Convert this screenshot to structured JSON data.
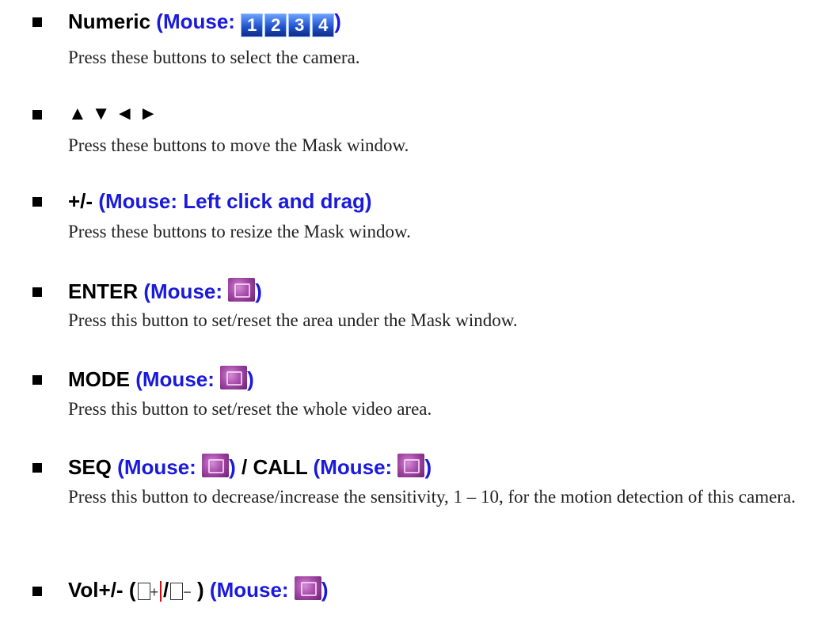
{
  "items": [
    {
      "head_main": "Numeric",
      "head_mouse": "(Mouse:",
      "head_close": ")",
      "numpad": [
        "1",
        "2",
        "3",
        "4"
      ],
      "icon": "numeric-keypad-icon",
      "desc": "Press these buttons to select the camera."
    },
    {
      "head_main": "▲▼◄►",
      "desc": "Press these buttons to move the Mask window."
    },
    {
      "head_main": "+/-",
      "head_mouse": "(Mouse: Left click and drag)",
      "desc": "Press these buttons to resize the Mask window."
    },
    {
      "head_main": "ENTER",
      "head_mouse": "(Mouse:",
      "head_close": ")",
      "icon": "enter-button-icon",
      "desc": "Press this button to set/reset the area under the Mask window."
    },
    {
      "head_main": "MODE",
      "head_mouse": "(Mouse:",
      "head_close": ")",
      "icon": "mode-button-icon",
      "desc": "Press this button to set/reset the whole video area."
    },
    {
      "head_main": "SEQ",
      "head_mouse": "(Mouse:",
      "head_close": ")",
      "sep": "/",
      "head_main2": "CALL",
      "head_mouse2": "(Mouse:",
      "head_close2": ")",
      "icon": "seq-button-icon",
      "icon2": "call-button-icon",
      "desc": "Press this button to decrease/increase the sensitivity, 1 – 10, for the motion detection of this camera."
    },
    {
      "head_main": "Vol+/-",
      "paren_open": "(",
      "plus": "+",
      "slash": "/",
      "minus": "−",
      "paren_close": ")",
      "head_mouse": "(Mouse:",
      "head_close": ")",
      "icon": "volume-button-icon"
    }
  ],
  "colors": {
    "mouse_text": "#1a1adc",
    "bullet": "#000000",
    "icon_purple": "#a54aa8",
    "numpad_blue": "#1f4fc8"
  }
}
